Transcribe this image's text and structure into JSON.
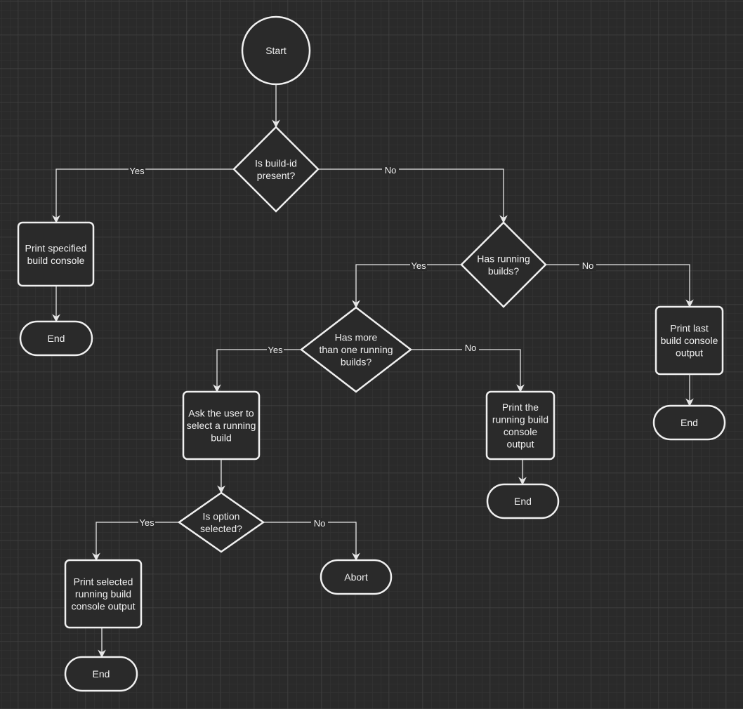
{
  "colors": {
    "background": "#2a2a2a",
    "stroke": "#f0f0f0",
    "text": "#f0f0f0"
  },
  "nodes": {
    "start": {
      "type": "circle",
      "lines": [
        "Start"
      ]
    },
    "d_build_id": {
      "type": "decision",
      "lines": [
        "Is build-id",
        "present?"
      ]
    },
    "p_specified": {
      "type": "process",
      "lines": [
        "Print specified",
        "build console"
      ]
    },
    "end1": {
      "type": "terminal",
      "lines": [
        "End"
      ]
    },
    "d_running": {
      "type": "decision",
      "lines": [
        "Has running",
        "builds?"
      ]
    },
    "d_more": {
      "type": "decision",
      "lines": [
        "Has more",
        "than one running",
        "builds?"
      ]
    },
    "p_last": {
      "type": "process",
      "lines": [
        "Print last",
        "build console",
        "output"
      ]
    },
    "end2": {
      "type": "terminal",
      "lines": [
        "End"
      ]
    },
    "p_ask": {
      "type": "process",
      "lines": [
        "Ask the user to",
        "select a running",
        "build"
      ]
    },
    "p_running": {
      "type": "process",
      "lines": [
        "Print the",
        "running build",
        "console",
        "output"
      ]
    },
    "end3": {
      "type": "terminal",
      "lines": [
        "End"
      ]
    },
    "d_option": {
      "type": "decision",
      "lines": [
        "Is option",
        "selected?"
      ]
    },
    "abort": {
      "type": "terminal",
      "lines": [
        "Abort"
      ]
    },
    "p_selected": {
      "type": "process",
      "lines": [
        "Print selected",
        "running build",
        "console output"
      ]
    },
    "end4": {
      "type": "terminal",
      "lines": [
        "End"
      ]
    }
  },
  "edges": [
    {
      "from": "start",
      "to": "d_build_id",
      "label": ""
    },
    {
      "from": "d_build_id",
      "to": "p_specified",
      "label": "Yes"
    },
    {
      "from": "d_build_id",
      "to": "d_running",
      "label": "No"
    },
    {
      "from": "p_specified",
      "to": "end1",
      "label": ""
    },
    {
      "from": "d_running",
      "to": "d_more",
      "label": "Yes"
    },
    {
      "from": "d_running",
      "to": "p_last",
      "label": "No"
    },
    {
      "from": "p_last",
      "to": "end2",
      "label": ""
    },
    {
      "from": "d_more",
      "to": "p_ask",
      "label": "Yes"
    },
    {
      "from": "d_more",
      "to": "p_running",
      "label": "No"
    },
    {
      "from": "p_ask",
      "to": "d_option",
      "label": ""
    },
    {
      "from": "p_running",
      "to": "end3",
      "label": ""
    },
    {
      "from": "d_option",
      "to": "p_selected",
      "label": "Yes"
    },
    {
      "from": "d_option",
      "to": "abort",
      "label": "No"
    },
    {
      "from": "p_selected",
      "to": "end4",
      "label": ""
    }
  ]
}
